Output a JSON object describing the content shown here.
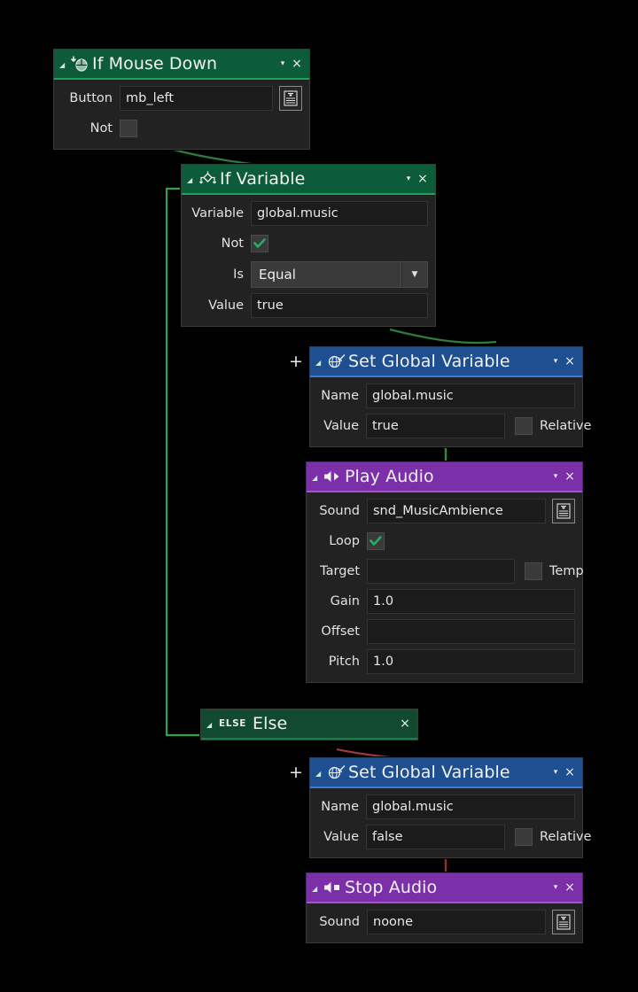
{
  "canvas": {
    "background": "#000000"
  },
  "colors": {
    "green_header": "#0d5c39",
    "green_underline": "#1ea35f",
    "blue_header": "#1d4f91",
    "blue_underline": "#3a7fd5",
    "purple_header": "#7b2fa8",
    "purple_underline": "#a94fd8",
    "wire_true": "#2f9e4f",
    "wire_false": "#9e3a3a",
    "check_green": "#27ae60"
  },
  "nodes": [
    {
      "id": "if-mouse-down",
      "title": "If Mouse Down",
      "icon": "mouse-down-icon",
      "collapse_label": "◢",
      "menu_label": "▾",
      "close_label": "×",
      "fields": {
        "button_label": "Button",
        "button_value": "mb_left",
        "not_label": "Not",
        "not_checked": false
      }
    },
    {
      "id": "if-variable",
      "title": "If Variable",
      "icon": "branch-diamond-icon",
      "collapse_label": "◢",
      "menu_label": "▾",
      "close_label": "×",
      "fields": {
        "variable_label": "Variable",
        "variable_value": "global.music",
        "not_label": "Not",
        "not_checked": true,
        "is_label": "Is",
        "is_value": "Equal",
        "value_label": "Value",
        "value_value": "true"
      }
    },
    {
      "id": "set-global-variable-true",
      "title": "Set Global Variable",
      "icon": "globe-set-icon",
      "plus_label": "+",
      "collapse_label": "◢",
      "menu_label": "▾",
      "close_label": "×",
      "fields": {
        "name_label": "Name",
        "name_value": "global.music",
        "value_label": "Value",
        "value_value": "true",
        "relative_label": "Relative",
        "relative_checked": false
      }
    },
    {
      "id": "play-audio",
      "title": "Play Audio",
      "icon": "speaker-play-icon",
      "collapse_label": "◢",
      "menu_label": "▾",
      "close_label": "×",
      "fields": {
        "sound_label": "Sound",
        "sound_value": "snd_MusicAmbience",
        "loop_label": "Loop",
        "loop_checked": true,
        "target_label": "Target",
        "target_value": "",
        "temp_label": "Temp",
        "temp_checked": false,
        "gain_label": "Gain",
        "gain_value": "1.0",
        "offset_label": "Offset",
        "offset_value": "",
        "pitch_label": "Pitch",
        "pitch_value": "1.0"
      }
    },
    {
      "id": "else",
      "title": "Else",
      "badge": "ELSE",
      "collapse_label": "◢",
      "close_label": "×"
    },
    {
      "id": "set-global-variable-false",
      "title": "Set Global Variable",
      "icon": "globe-set-icon",
      "plus_label": "+",
      "collapse_label": "◢",
      "menu_label": "▾",
      "close_label": "×",
      "fields": {
        "name_label": "Name",
        "name_value": "global.music",
        "value_label": "Value",
        "value_value": "false",
        "relative_label": "Relative",
        "relative_checked": false
      }
    },
    {
      "id": "stop-audio",
      "title": "Stop Audio",
      "icon": "speaker-stop-icon",
      "collapse_label": "◢",
      "menu_label": "▾",
      "close_label": "×",
      "fields": {
        "sound_label": "Sound",
        "sound_value": "noone"
      }
    }
  ]
}
